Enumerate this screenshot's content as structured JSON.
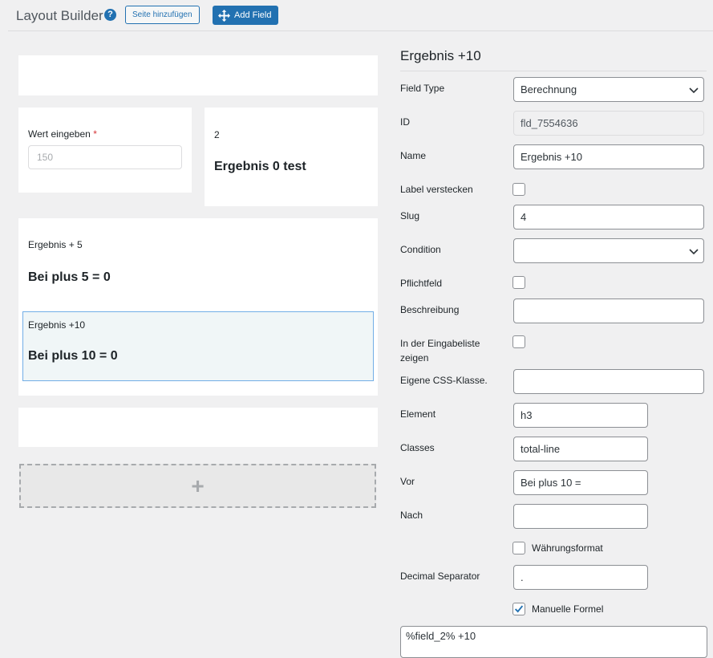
{
  "header": {
    "title": "Layout Builder",
    "help_icon": "?",
    "add_page_label": "Seite hinzufügen",
    "add_field_label": "Add Field"
  },
  "canvas": {
    "input_field": {
      "label": "Wert eingeben",
      "required_mark": "*",
      "placeholder": "150"
    },
    "field_2": {
      "label": "2",
      "value": "Ergebnis 0 test"
    },
    "field_plus5": {
      "label": "Ergebnis + 5",
      "value": "Bei plus 5 = 0"
    },
    "field_plus10": {
      "label": "Ergebnis +10",
      "value": "Bei plus 10 = 0"
    },
    "add_row_icon": "+"
  },
  "settings": {
    "title": "Ergebnis +10",
    "rows": {
      "field_type": {
        "label": "Field Type",
        "value": "Berechnung"
      },
      "id": {
        "label": "ID",
        "value": "fld_7554636"
      },
      "name": {
        "label": "Name",
        "value": "Ergebnis +10"
      },
      "hide_label": {
        "label": "Label verstecken"
      },
      "slug": {
        "label": "Slug",
        "value": "4"
      },
      "condition": {
        "label": "Condition",
        "value": ""
      },
      "required": {
        "label": "Pflichtfeld"
      },
      "description": {
        "label": "Beschreibung",
        "value": ""
      },
      "entry_list": {
        "label": "In der Eingabeliste zeigen"
      },
      "css_class": {
        "label": "Eigene CSS-Klasse.",
        "value": ""
      },
      "element": {
        "label": "Element",
        "value": "h3"
      },
      "classes": {
        "label": "Classes",
        "value": "total-line"
      },
      "before": {
        "label": "Vor",
        "value": "Bei plus 10 ="
      },
      "after": {
        "label": "Nach",
        "value": ""
      },
      "currency": {
        "label": "Währungsformat",
        "checked": false
      },
      "decimal_separator": {
        "label": "Decimal Separator",
        "value": "."
      },
      "manual_formula": {
        "label": "Manuelle Formel",
        "checked": true
      },
      "formula": {
        "value": "%field_2% +10"
      }
    }
  },
  "colors": {
    "accent": "#2271b1",
    "selection_border": "#72aee6",
    "required": "#d63638"
  }
}
